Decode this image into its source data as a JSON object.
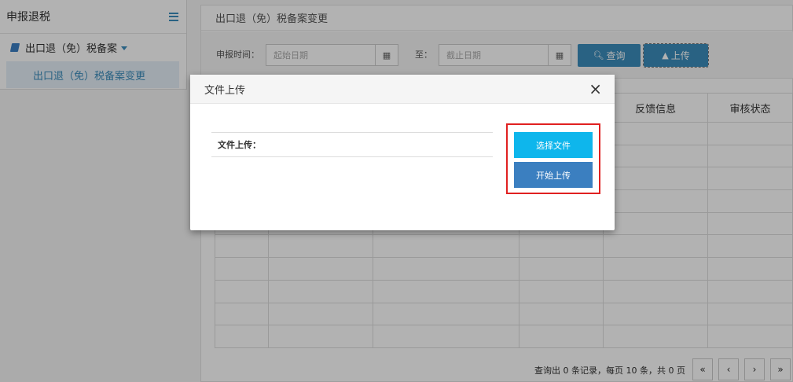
{
  "sidebar": {
    "title": "申报退税",
    "group_label": "出口退（免）税备案",
    "sub_item": "出口退（免）税备案变更"
  },
  "main": {
    "title": "出口退（免）税备案变更",
    "filters": {
      "date_label": "申报时间：",
      "start_placeholder": "起始日期",
      "to_label": "至：",
      "end_placeholder": "截止日期",
      "query_label": "查询",
      "upload_label": "上传"
    },
    "table": {
      "headers": [
        "",
        "",
        "",
        "",
        "反馈信息",
        "审核状态"
      ]
    },
    "pager": {
      "summary": "查询出 0 条记录，每页 10 条，共 0 页",
      "first": "«",
      "prev": "‹",
      "next": "›",
      "last": "»"
    }
  },
  "modal": {
    "title": "文件上传",
    "close": "×",
    "field_label": "文件上传：",
    "select_file": "选择文件",
    "start_upload": "开始上传"
  },
  "colors": {
    "primary": "#3c8dbc",
    "select_button": "#0eb6ec",
    "start_button": "#3b7fc0",
    "highlight_border": "#e02020"
  }
}
